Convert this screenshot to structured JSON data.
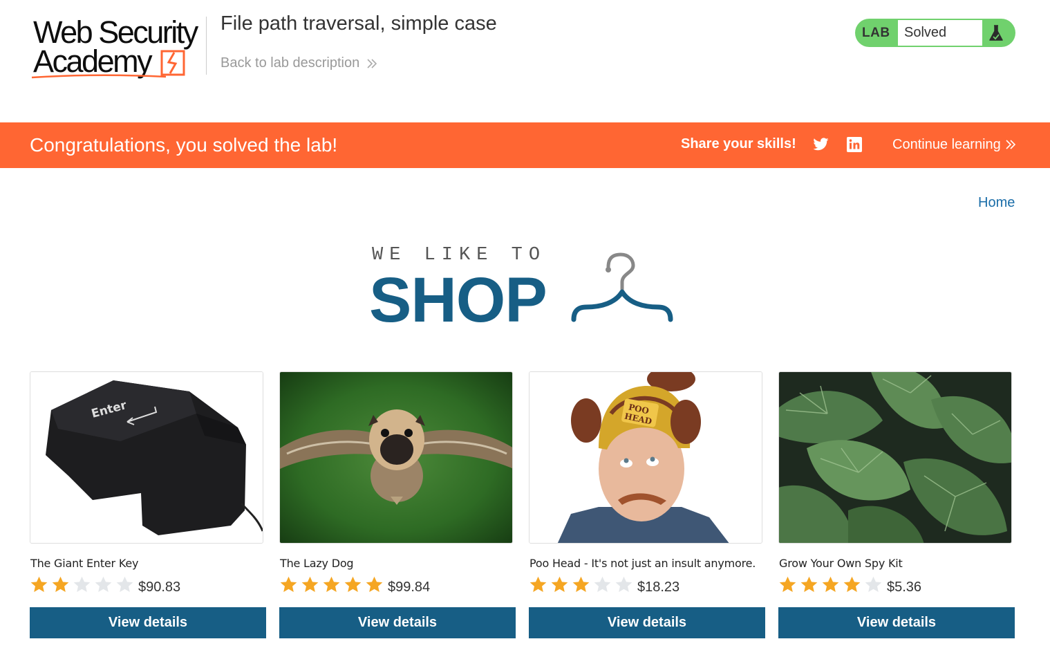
{
  "header": {
    "logo_line1": "Web Security",
    "logo_line2": "Academy",
    "lab_title": "File path traversal, simple case",
    "back_link": "Back to lab description",
    "status_prefix": "LAB",
    "status": "Solved",
    "accent_green": "#70d16d"
  },
  "banner": {
    "message": "Congratulations, you solved the lab!",
    "share_label": "Share your skills!",
    "continue_label": "Continue learning",
    "color": "#ff6633"
  },
  "nav": {
    "home": "Home"
  },
  "shop_logo": {
    "tagline": "WE LIKE TO",
    "word": "SHOP",
    "color": "#175e85"
  },
  "products": [
    {
      "name": "The Giant Enter Key",
      "rating": 2,
      "price": "$90.83",
      "button": "View details",
      "image_icon": "giant-enter-key-image"
    },
    {
      "name": "The Lazy Dog",
      "rating": 5,
      "price": "$99.84",
      "button": "View details",
      "image_icon": "flying-pug-image"
    },
    {
      "name": "Poo Head - It's not just an insult anymore.",
      "rating": 3,
      "price": "$18.23",
      "button": "View details",
      "image_icon": "poo-head-hat-image"
    },
    {
      "name": "Grow Your Own Spy Kit",
      "rating": 4,
      "price": "$5.36",
      "button": "View details",
      "image_icon": "leaves-image"
    }
  ]
}
